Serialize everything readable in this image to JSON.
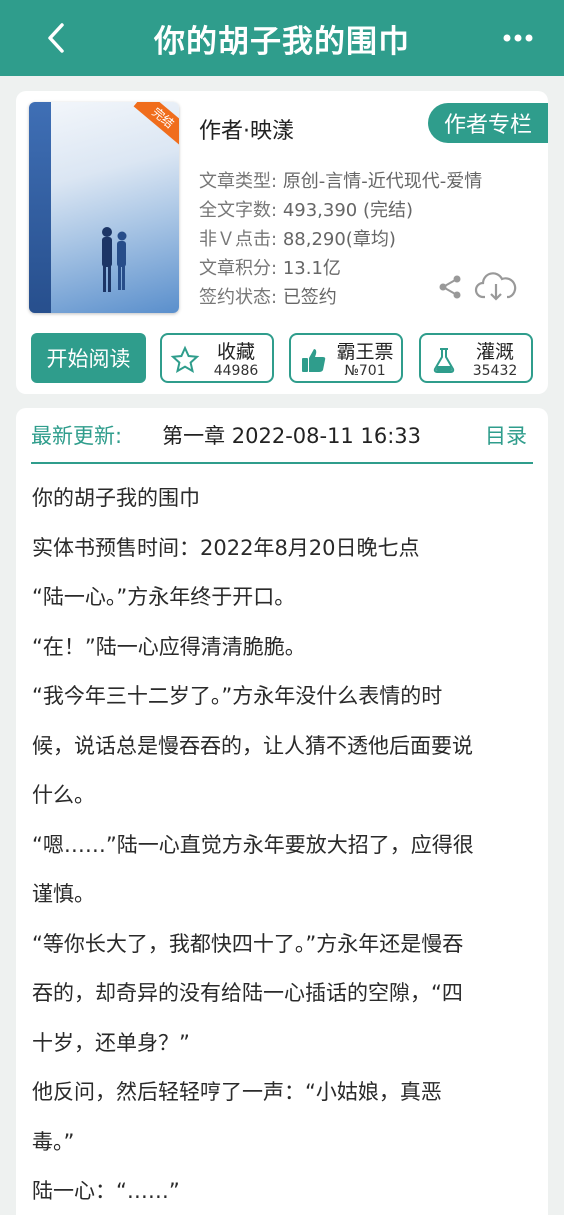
{
  "header": {
    "title": "你的胡子我的围巾",
    "back_icon": "chevron-left-icon",
    "more_icon": "more-dots-icon"
  },
  "book": {
    "cover_badge": "完结",
    "author": "作者·映漾",
    "author_column_label": "作者专栏",
    "meta": [
      {
        "key": "文章类型:",
        "value": "原创-言情-近代现代-爱情"
      },
      {
        "key": "全文字数:",
        "value": "493,390 (完结)"
      },
      {
        "key": "非Ｖ点击:",
        "value": "88,290(章均)"
      },
      {
        "key": "文章积分:",
        "value": "13.1亿"
      },
      {
        "key": "签约状态:",
        "value": "已签约"
      }
    ]
  },
  "actions": {
    "start_read": "开始阅读",
    "favorite": {
      "label": "收藏",
      "count": "44986"
    },
    "overlord": {
      "label": "霸王票",
      "count": "№701"
    },
    "irrigate": {
      "label": "灌溉",
      "count": "35432"
    }
  },
  "latest": {
    "label": "最新更新:",
    "info": "第一章  2022-08-11 16:33",
    "toc": "目录"
  },
  "text_lines": [
    "你的胡子我的围巾",
    "实体书预售时间：2022年8月20日晚七点",
    "“陆一心。”方永年终于开口。",
    "“在！”陆一心应得清清脆脆。",
    "“我今年三十二岁了。”方永年没什么表情的时",
    "候，说话总是慢吞吞的，让人猜不透他后面要说",
    "什么。",
    "“嗯……”陆一心直觉方永年要放大招了，应得很",
    "谨慎。",
    "“等你长大了，我都快四十了。”方永年还是慢吞",
    "吞的，却奇异的没有给陆一心插话的空隙，“四",
    "十岁，还单身？”",
    "他反问，然后轻轻哼了一声：“小姑娘，真恶",
    "毒。”",
    "陆一心：“……”"
  ],
  "colors": {
    "accent": "#2f9d8c",
    "badge": "#f06d1c"
  }
}
